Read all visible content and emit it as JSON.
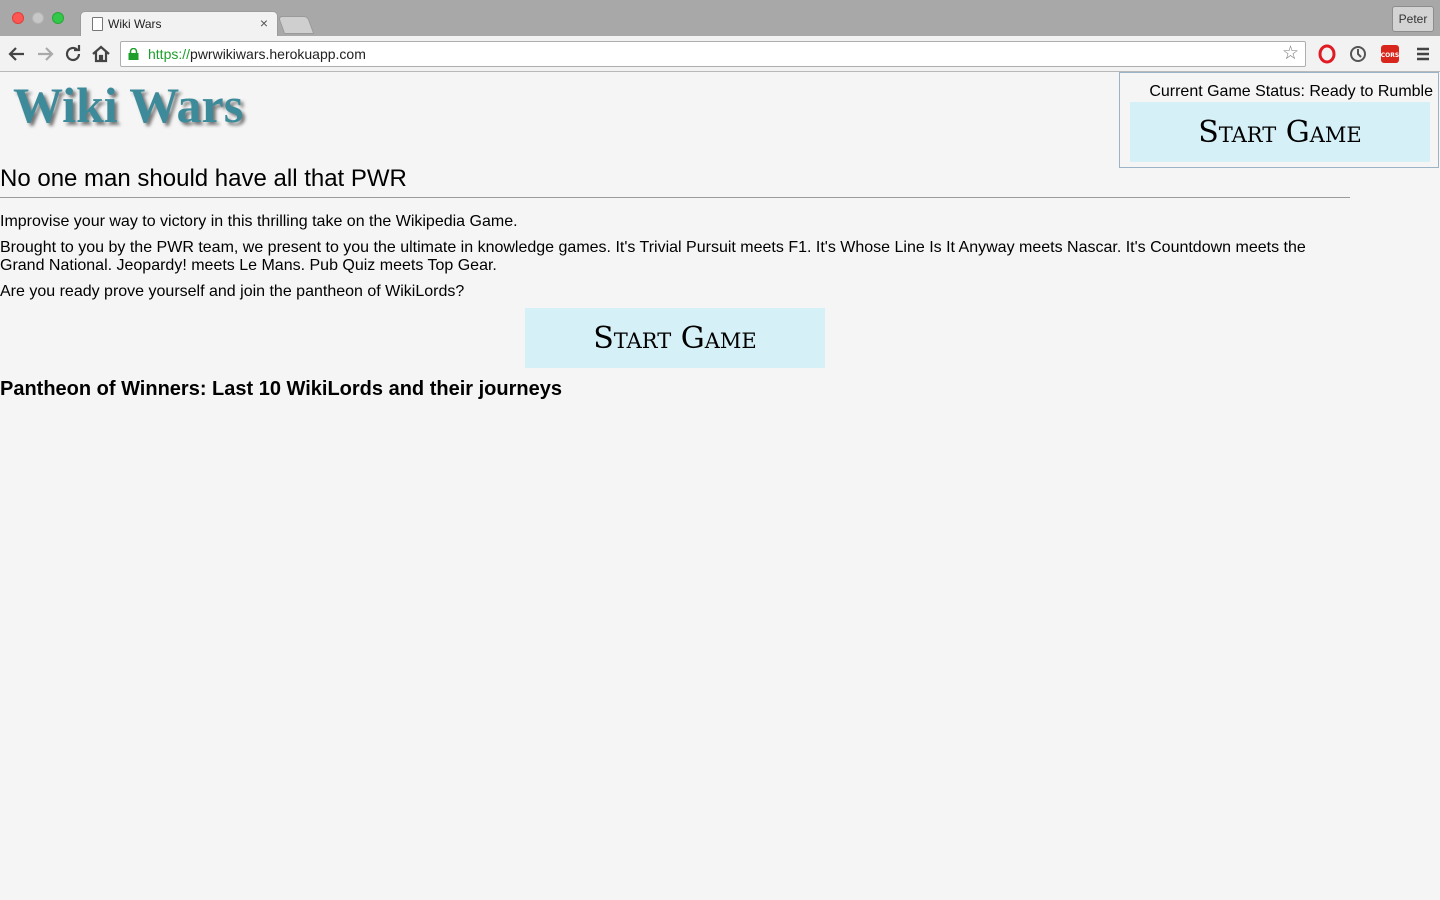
{
  "browser": {
    "tab_title": "Wiki Wars",
    "tab_close": "×",
    "url_scheme": "https://",
    "url_rest": "pwrwikiwars.herokuapp.com",
    "profile_name": "Peter",
    "icons": {
      "back": "back-arrow-icon",
      "forward": "forward-arrow-icon",
      "reload": "reload-icon",
      "home": "home-icon",
      "lock": "lock-icon",
      "star": "bookmark-star-icon",
      "opera": "opera-extension-icon",
      "sync": "sync-extension-icon",
      "cors": "cors-extension-icon",
      "menu": "hamburger-menu-icon"
    },
    "cors_label": "CORS"
  },
  "page": {
    "logo": "Wiki Wars",
    "status_label": "Current Game Status: Ready to Rumble",
    "start_button_top": "Start Game",
    "tagline": "No one man should have all that PWR",
    "paragraphs": [
      "Improvise your way to victory in this thrilling take on the Wikipedia Game.",
      "Brought to you by the PWR team, we present to you the ultimate in knowledge games. It's Trivial Pursuit meets F1. It's Whose Line Is It Anyway meets Nascar. It's Countdown meets the Grand National. Jeopardy! meets Le Mans. Pub Quiz meets Top Gear.",
      "Are you ready prove yourself and join the pantheon of WikiLords?"
    ],
    "start_button_main": "Start Game",
    "pantheon_heading": "Pantheon of Winners: Last 10 WikiLords and their journeys"
  },
  "colors": {
    "logo": "#3d8b9a",
    "button_bg": "#d6f0f7",
    "url_scheme": "#1e9f2c",
    "page_bg": "#f5f5f5"
  }
}
